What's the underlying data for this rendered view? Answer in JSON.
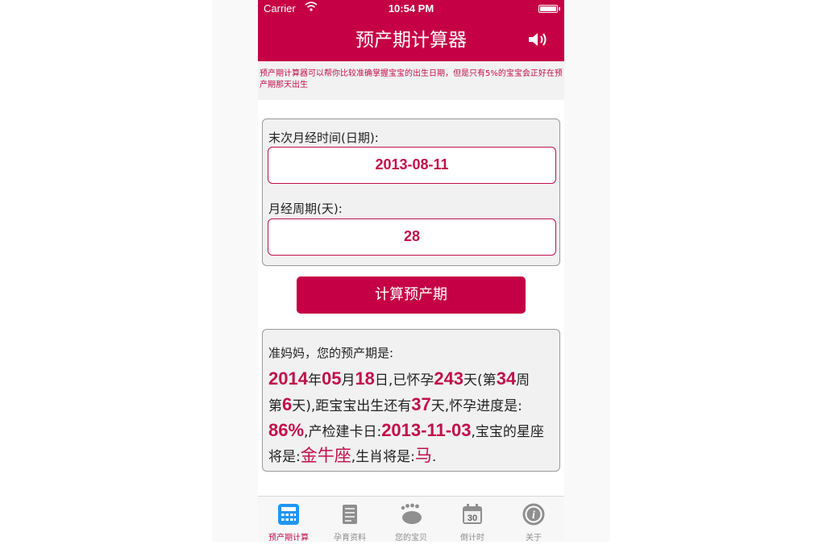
{
  "status_bar": {
    "carrier": "Carrier",
    "time": "10:54 PM"
  },
  "nav": {
    "title": "预产期计算器",
    "speaker_icon": "speaker-icon"
  },
  "colors": {
    "accent": "#c50045",
    "accent_text": "#c0104a",
    "tab_active": "#2196f3"
  },
  "notice": "预产期计算器可以帮你比较准确掌握宝宝的出生日期，但是只有5%的宝宝会正好在预产期那天出生",
  "form": {
    "last_period_label": "末次月经时间(日期):",
    "last_period_value": "2013-08-11",
    "cycle_label": "月经周期(天):",
    "cycle_value": "28"
  },
  "calculate_button": "计算预产期",
  "result": {
    "heading": "准妈妈，您的预产期是:",
    "year": "2014",
    "t_year": "年",
    "month": "05",
    "t_month": "月",
    "day": "18",
    "t_day": "日,已怀孕",
    "days_pregnant": "243",
    "t_days": "天(第",
    "week": "34",
    "t_week": "周",
    "t_di": "第",
    "week_day": "6",
    "t_weekday": "天),距宝宝出生还有",
    "days_left": "37",
    "t_progress": "天,怀孕进度是:",
    "progress": "86%",
    "t_checkup": ",产检建卡日:",
    "checkup_date": "2013-11-03",
    "t_zodiac": ",宝宝的星座将是:",
    "zodiac": "金牛座",
    "t_animal": ",生肖将是:",
    "animal": "马",
    "t_end": "."
  },
  "tabs": [
    {
      "label": "预产期计算",
      "icon": "calculator-icon",
      "active": true
    },
    {
      "label": "孕育资料",
      "icon": "document-icon",
      "active": false
    },
    {
      "label": "您的宝贝",
      "icon": "footprint-icon",
      "active": false
    },
    {
      "label": "倒计时",
      "icon": "calendar-icon",
      "active": false,
      "icon_text": "30"
    },
    {
      "label": "关于",
      "icon": "info-icon",
      "active": false,
      "icon_text": "i"
    }
  ]
}
